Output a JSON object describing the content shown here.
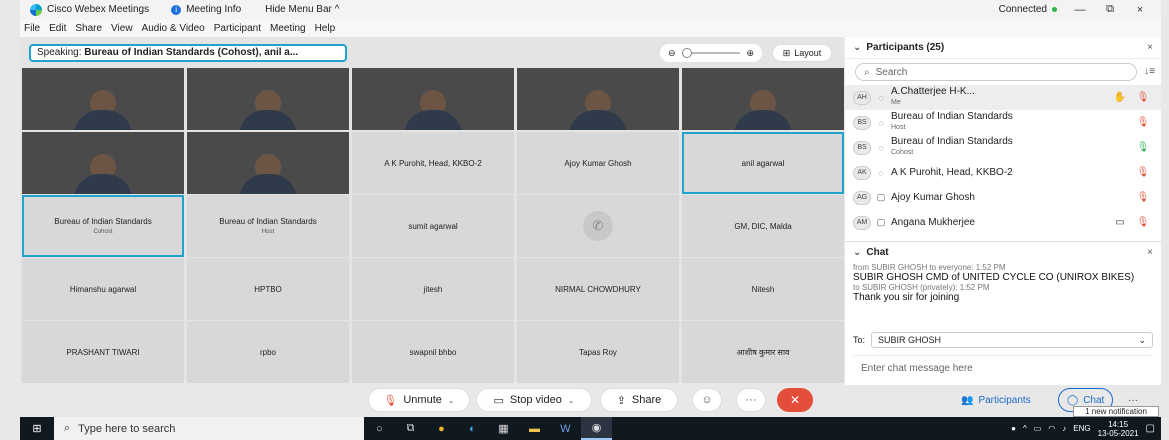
{
  "titlebar": {
    "app_name": "Cisco Webex Meetings",
    "tab_label": "Meeting Info",
    "hide_menu_label": "Hide Menu Bar ^",
    "status": "Connected",
    "minimize_glyph": "—",
    "restore_glyph": "⧉",
    "close_glyph": "×"
  },
  "menubar": [
    "File",
    "Edit",
    "Share",
    "View",
    "Audio & Video",
    "Participant",
    "Meeting",
    "Help"
  ],
  "stage": {
    "speaking_prefix": "Speaking: ",
    "speaking_name": "Bureau of Indian Standards (Cohost), anil a...",
    "layout_label": "Layout"
  },
  "tiles": [
    {
      "type": "video",
      "style": "v1"
    },
    {
      "type": "video",
      "style": "v2"
    },
    {
      "type": "video",
      "style": "v3"
    },
    {
      "type": "video",
      "style": "v4"
    },
    {
      "type": "video",
      "style": "v5"
    },
    {
      "type": "video",
      "style": "v6"
    },
    {
      "type": "video",
      "style": "v7"
    },
    {
      "type": "name",
      "name": "A K Purohit, Head, KKBO-2"
    },
    {
      "type": "name",
      "name": "Ajoy Kumar Ghosh"
    },
    {
      "type": "name",
      "name": "anil agarwal",
      "active": true
    },
    {
      "type": "name",
      "name": "Bureau of Indian Standards",
      "sub": "Cohost",
      "active": true
    },
    {
      "type": "name",
      "name": "Bureau of Indian Standards",
      "sub": "Host"
    },
    {
      "type": "name",
      "name": "sumit agarwal"
    },
    {
      "type": "phone"
    },
    {
      "type": "name",
      "name": "GM, DIC, Malda"
    },
    {
      "type": "name",
      "name": "Himanshu agarwal"
    },
    {
      "type": "name",
      "name": "HPTBO"
    },
    {
      "type": "name",
      "name": "jitesh"
    },
    {
      "type": "name",
      "name": "NIRMAL CHOWDHURY"
    },
    {
      "type": "name",
      "name": "Nitesh"
    },
    {
      "type": "name",
      "name": "PRASHANT TIWARI"
    },
    {
      "type": "name",
      "name": "rpbo"
    },
    {
      "type": "name",
      "name": "swapnil bhbo"
    },
    {
      "type": "name",
      "name": "Tapas Roy"
    },
    {
      "type": "name",
      "name": "आशीष कुमार साव"
    }
  ],
  "controls": {
    "unmute": "Unmute",
    "stop_video": "Stop video",
    "share": "Share",
    "participants": "Participants",
    "chat": "Chat",
    "more": "···"
  },
  "participants_panel": {
    "title": "Participants (25)",
    "search_placeholder": "Search",
    "rows": [
      {
        "initials": "AH",
        "name": "A.Chatterjee H-K...",
        "role": "Me",
        "mic": "muted",
        "extra": "✋"
      },
      {
        "initials": "BS",
        "name": "Bureau of Indian Standards",
        "role": "Host",
        "mic": "muted",
        "extra": ""
      },
      {
        "initials": "BS",
        "name": "Bureau of Indian Standards",
        "role": "Cohost",
        "mic": "on",
        "extra": ""
      },
      {
        "initials": "AK",
        "name": "A K Purohit, Head, KKBO-2",
        "role": "",
        "mic": "muted",
        "extra": ""
      },
      {
        "initials": "AG",
        "name": "Ajoy Kumar Ghosh",
        "role": "",
        "mic": "muted",
        "extra": ""
      },
      {
        "initials": "AM",
        "name": "Angana Mukherjee",
        "role": "",
        "mic": "muted",
        "extra": "▭"
      }
    ]
  },
  "chat_panel": {
    "title": "Chat",
    "messages": [
      {
        "meta": "from SUBIR GHOSH to everyone:   1:52 PM",
        "text": "SUBIR GHOSH CMD of UNITED CYCLE CO (UNIROX BIKES)"
      },
      {
        "meta": "to SUBIR GHOSH (privately):   1:52 PM",
        "text": "Thank you sir for joining"
      }
    ],
    "to_label": "To:",
    "to_value": "SUBIR GHOSH",
    "input_placeholder": "Enter chat message here"
  },
  "notification": "1 new notification",
  "taskbar": {
    "search_placeholder": "Type here to search",
    "lang": "ENG",
    "time": "14:15",
    "date": "13-05-2021"
  }
}
